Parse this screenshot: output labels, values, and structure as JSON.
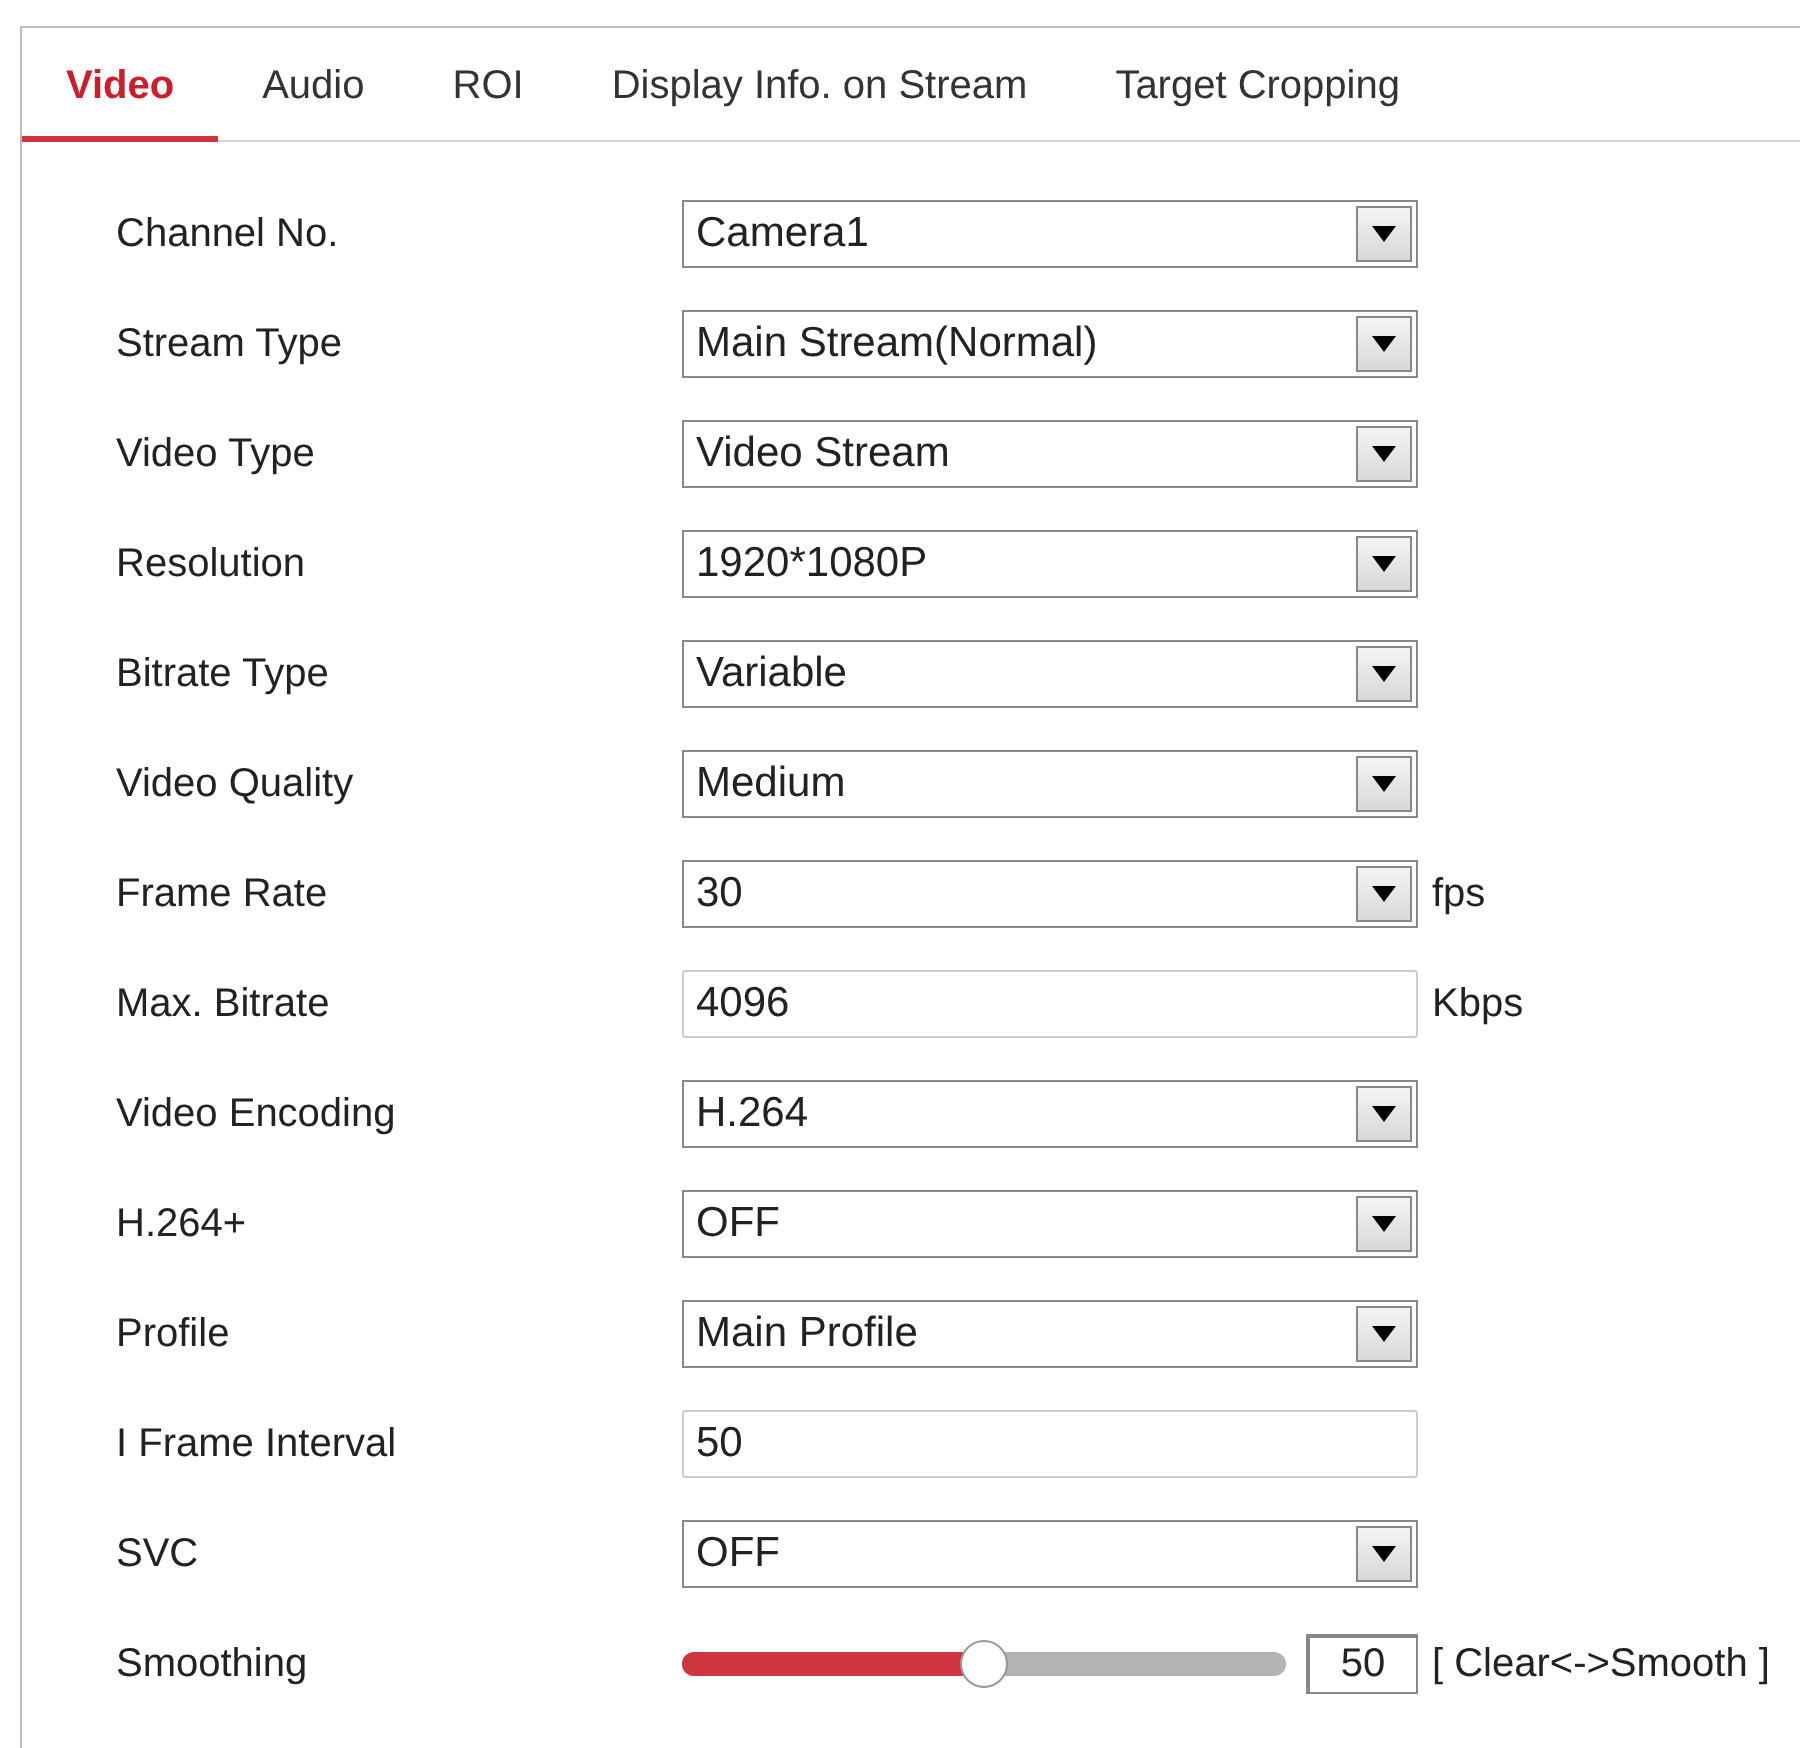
{
  "tabs": [
    {
      "label": "Video",
      "selected": true
    },
    {
      "label": "Audio",
      "selected": false
    },
    {
      "label": "ROI",
      "selected": false
    },
    {
      "label": "Display Info. on Stream",
      "selected": false
    },
    {
      "label": "Target Cropping",
      "selected": false
    }
  ],
  "fields": [
    {
      "kind": "select",
      "label": "Channel No.",
      "value": "Camera1"
    },
    {
      "kind": "select",
      "label": "Stream Type",
      "value": "Main Stream(Normal)"
    },
    {
      "kind": "select",
      "label": "Video Type",
      "value": "Video Stream"
    },
    {
      "kind": "select",
      "label": "Resolution",
      "value": "1920*1080P"
    },
    {
      "kind": "select",
      "label": "Bitrate Type",
      "value": "Variable"
    },
    {
      "kind": "select",
      "label": "Video Quality",
      "value": "Medium"
    },
    {
      "kind": "select",
      "label": "Frame Rate",
      "value": "30",
      "unit": "fps"
    },
    {
      "kind": "input",
      "label": "Max. Bitrate",
      "value": "4096",
      "unit": "Kbps"
    },
    {
      "kind": "select",
      "label": "Video Encoding",
      "value": "H.264"
    },
    {
      "kind": "select",
      "label": "H.264+",
      "value": "OFF"
    },
    {
      "kind": "select",
      "label": "Profile",
      "value": "Main Profile"
    },
    {
      "kind": "input",
      "label": "I Frame Interval",
      "value": "50"
    },
    {
      "kind": "select",
      "label": "SVC",
      "value": "OFF"
    },
    {
      "kind": "slider",
      "label": "Smoothing",
      "level": 0.5,
      "value": "50",
      "unit": "[ Clear<->Smooth ]"
    }
  ]
}
